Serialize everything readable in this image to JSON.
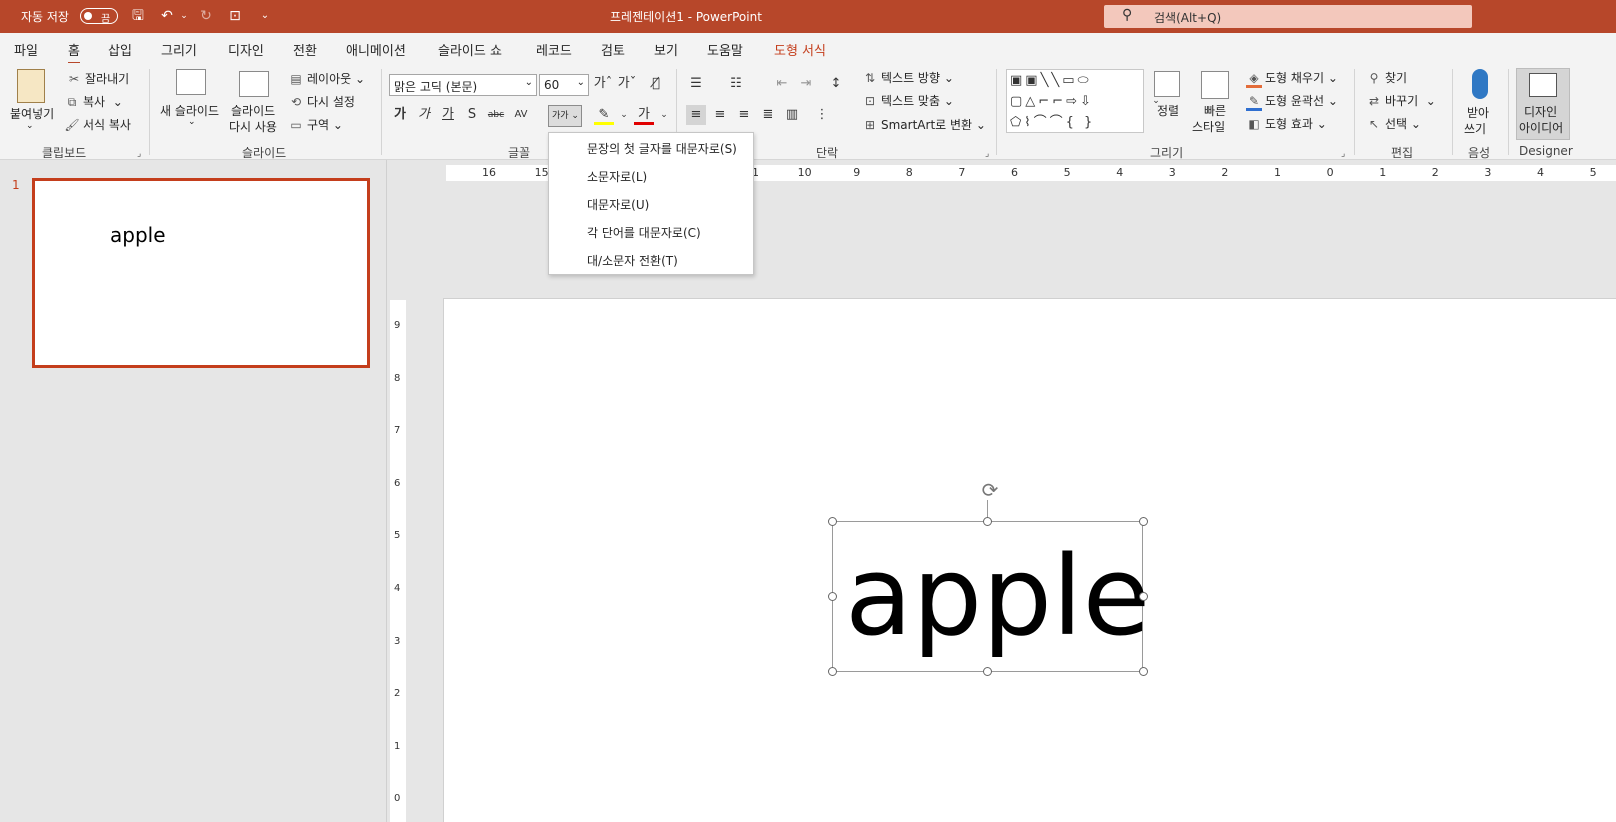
{
  "titlebar": {
    "autosave_label": "자동 저장",
    "autosave_state": "끔",
    "title": "프레젠테이션1 - PowerPoint",
    "search_placeholder": "검색(Alt+Q)"
  },
  "tabs": [
    "파일",
    "홈",
    "삽입",
    "그리기",
    "디자인",
    "전환",
    "애니메이션",
    "슬라이드 쇼",
    "레코드",
    "검토",
    "보기",
    "도움말",
    "도형 서식"
  ],
  "active_tab": "홈",
  "ribbon": {
    "clipboard": {
      "paste": "붙여넣기",
      "cut": "잘라내기",
      "copy": "복사",
      "format_painter": "서식 복사",
      "label": "클립보드"
    },
    "slides": {
      "new_slide": "새 슬라이드",
      "reuse1": "슬라이드",
      "reuse2": "다시 사용",
      "layout": "레이아웃",
      "reset": "다시 설정",
      "section": "구역",
      "label": "슬라이드"
    },
    "font": {
      "font_name": "맑은 고딕 (본문)",
      "font_size": "60",
      "label": "글꼴",
      "bold": "가",
      "italic": "가",
      "underline": "가",
      "shadow": "S",
      "strike": "abc",
      "spacing": "AV",
      "case": "가가"
    },
    "paragraph": {
      "text_direction": "텍스트 방향",
      "align_text": "텍스트 맞춤",
      "smartart": "SmartArt로 변환",
      "label": "단락"
    },
    "drawing": {
      "arrange": "정렬",
      "quick1": "빠른",
      "quick2": "스타일",
      "fill": "도형 채우기",
      "outline": "도형 윤곽선",
      "effects": "도형 효과",
      "label": "그리기"
    },
    "editing": {
      "find": "찾기",
      "replace": "바꾸기",
      "select": "선택",
      "label": "편집"
    },
    "voice": {
      "dictate1": "받아",
      "dictate2": "쓰기",
      "label": "음성"
    },
    "designer": {
      "ideas1": "디자인",
      "ideas2": "아이디어",
      "label": "Designer"
    }
  },
  "case_menu": {
    "items": [
      "문장의 첫 글자를 대문자로(S)",
      "소문자로(L)",
      "대문자로(U)",
      "각 단어를 대문자로(C)",
      "대/소문자 전환(T)"
    ]
  },
  "slides_panel": {
    "number": "1",
    "thumb_text": "apple"
  },
  "slide": {
    "text": "apple"
  },
  "colors": {
    "accent": "#b7472a",
    "selection": "#c43e1c"
  }
}
